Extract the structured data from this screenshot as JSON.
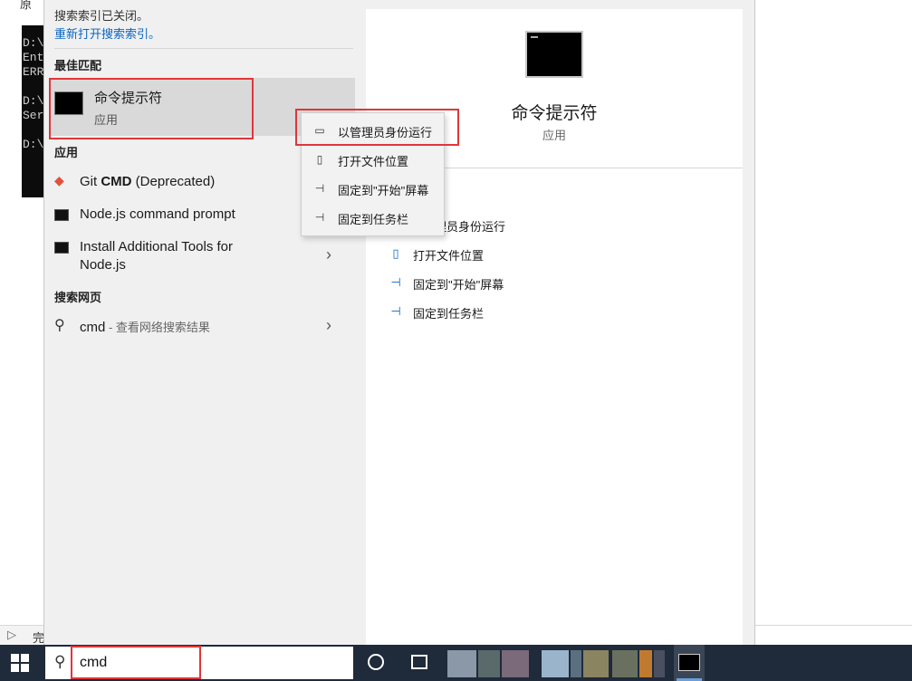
{
  "background": {
    "top_text": "原",
    "console_lines": [
      "D:\\",
      "Ent",
      "ERR",
      "",
      "D:\\",
      "Ser",
      "",
      "D:\\"
    ],
    "bottom_text": "完"
  },
  "search_notice": {
    "text": "搜索索引已关闭。",
    "link": "重新打开搜索索引。"
  },
  "sections": {
    "best_match": "最佳匹配",
    "apps": "应用",
    "web": "搜索网页"
  },
  "best_match": {
    "title": "命令提示符",
    "subtitle": "应用"
  },
  "apps": [
    {
      "prefix": "Git ",
      "bold": "CMD",
      "suffix": " (Deprecated)",
      "icon": "git-icon"
    },
    {
      "prefix": "Node.js command prompt",
      "bold": "",
      "suffix": "",
      "icon": "console-icon"
    },
    {
      "prefix": "Install Additional Tools for",
      "line2": "Node.js",
      "icon": "console-icon"
    }
  ],
  "web_result": {
    "query": "cmd",
    "suffix": " - 查看网络搜索结果"
  },
  "preview": {
    "title": "命令提示符",
    "subtitle": "应用",
    "actions": [
      "以管理员身份运行",
      "打开文件位置",
      "固定到\"开始\"屏幕",
      "固定到任务栏"
    ],
    "actions_visible_first": "理员身份运行"
  },
  "context_menu": {
    "items": [
      "以管理员身份运行",
      "打开文件位置",
      "固定到\"开始\"屏幕",
      "固定到任务栏"
    ]
  },
  "taskbar": {
    "search_value": "cmd"
  },
  "colors": {
    "accent_link": "#0a66c2",
    "highlight_box": "#e0363a",
    "taskbar": "#1f2a3a"
  }
}
